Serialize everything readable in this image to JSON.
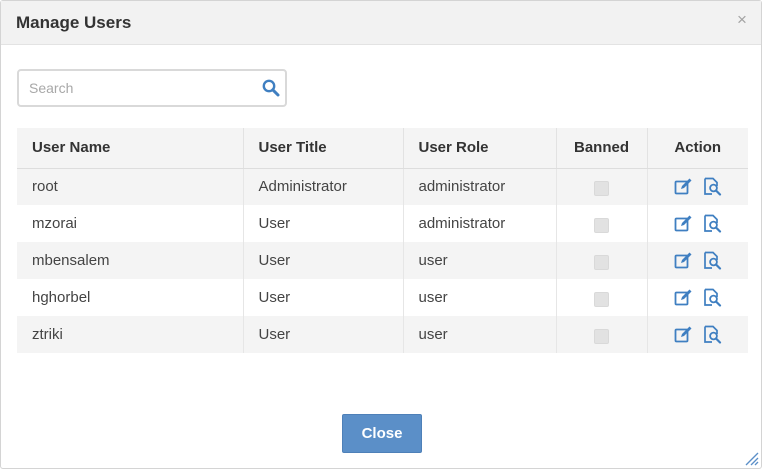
{
  "dialog": {
    "title": "Manage Users",
    "close_glyph": "×"
  },
  "search": {
    "placeholder": "Search",
    "value": "",
    "icon": "search-icon"
  },
  "table": {
    "columns": [
      "User Name",
      "User Title",
      "User Role",
      "Banned",
      "Action"
    ],
    "rows": [
      {
        "user_name": "root",
        "user_title": "Administrator",
        "user_role": "administrator",
        "banned": false
      },
      {
        "user_name": "mzorai",
        "user_title": "User",
        "user_role": "administrator",
        "banned": false
      },
      {
        "user_name": "mbensalem",
        "user_title": "User",
        "user_role": "user",
        "banned": false
      },
      {
        "user_name": "hghorbel",
        "user_title": "User",
        "user_role": "user",
        "banned": false
      },
      {
        "user_name": "ztriki",
        "user_title": "User",
        "user_role": "user",
        "banned": false
      }
    ],
    "action_icons": [
      "edit-icon",
      "view-details-icon"
    ]
  },
  "footer": {
    "close_label": "Close"
  },
  "colors": {
    "accent": "#5b8fc8",
    "icon_blue": "#3f7fc1",
    "header_bg": "#f4f4f4"
  }
}
